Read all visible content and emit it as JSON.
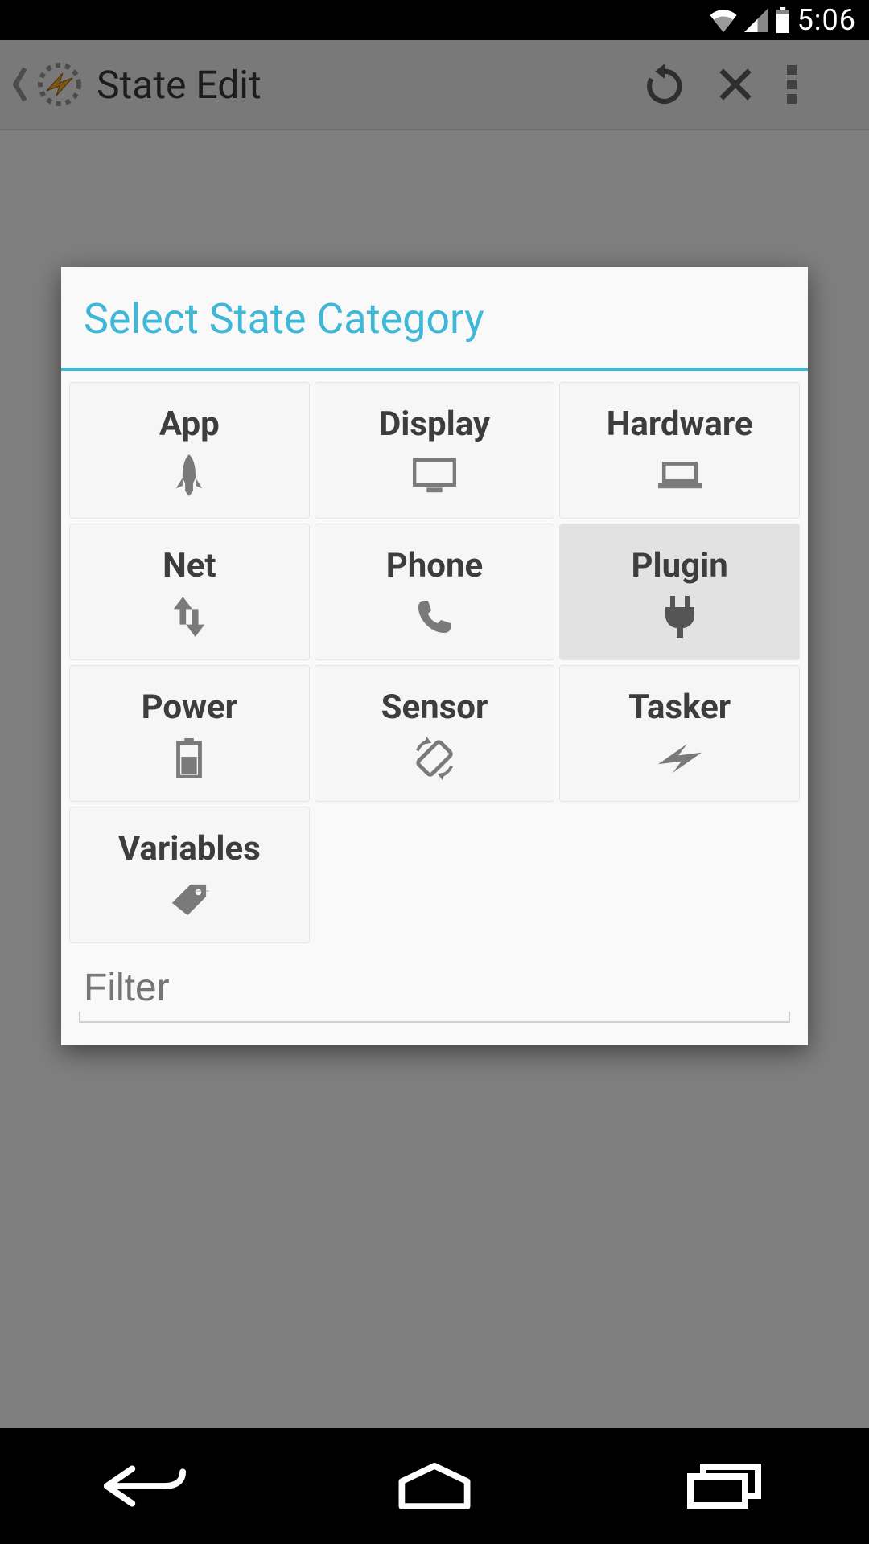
{
  "status": {
    "time": "5:06"
  },
  "appbar": {
    "title": "State Edit"
  },
  "dialog": {
    "title": "Select State Category",
    "filter_placeholder": "Filter",
    "items": [
      {
        "label": "App",
        "icon": "rocket-icon",
        "selected": false
      },
      {
        "label": "Display",
        "icon": "monitor-icon",
        "selected": false
      },
      {
        "label": "Hardware",
        "icon": "laptop-icon",
        "selected": false
      },
      {
        "label": "Net",
        "icon": "updown-icon",
        "selected": false
      },
      {
        "label": "Phone",
        "icon": "phone-icon",
        "selected": false
      },
      {
        "label": "Plugin",
        "icon": "plug-icon",
        "selected": true
      },
      {
        "label": "Power",
        "icon": "battery-icon",
        "selected": false
      },
      {
        "label": "Sensor",
        "icon": "rotate-icon",
        "selected": false
      },
      {
        "label": "Tasker",
        "icon": "bolt-icon",
        "selected": false
      },
      {
        "label": "Variables",
        "icon": "tag-icon",
        "selected": false
      }
    ]
  }
}
